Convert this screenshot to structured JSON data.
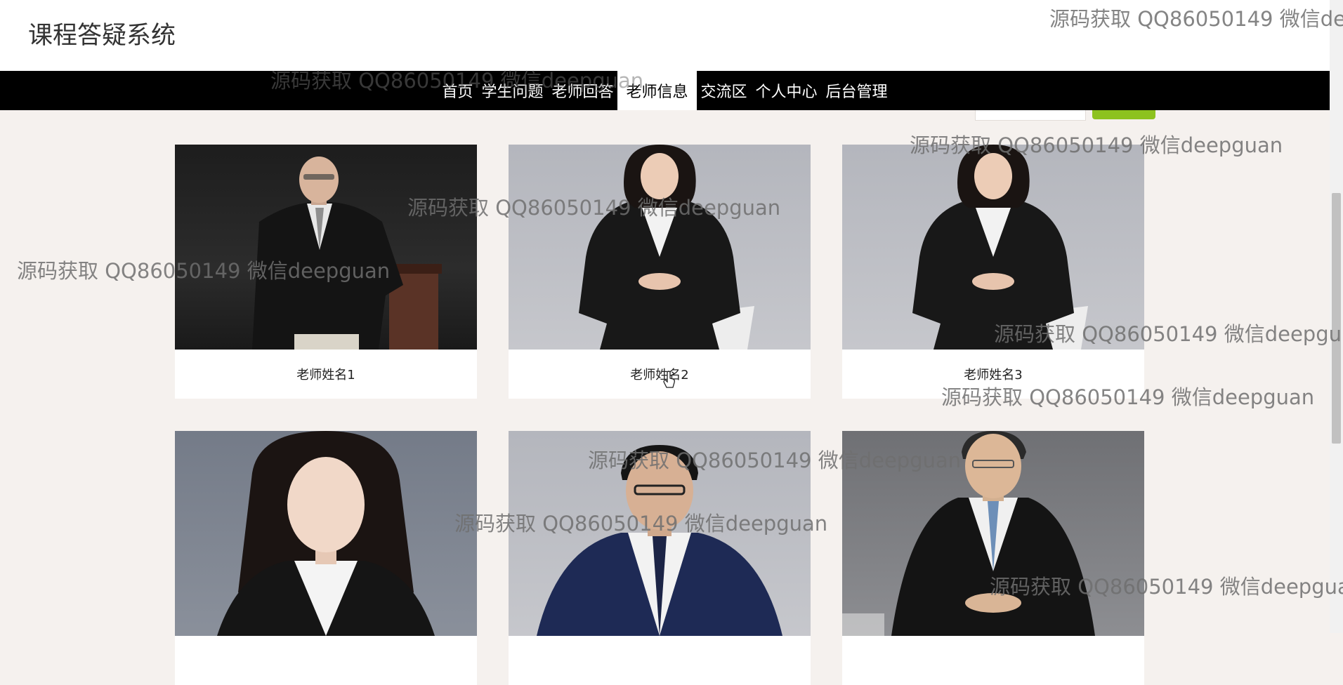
{
  "header": {
    "site_title": "课程答疑系统"
  },
  "nav": {
    "items": [
      {
        "label": "首页",
        "active": false
      },
      {
        "label": "学生问题",
        "active": false
      },
      {
        "label": "老师回答",
        "active": false
      },
      {
        "label": "老师信息",
        "active": true
      },
      {
        "label": "交流区",
        "active": false
      },
      {
        "label": "个人中心",
        "active": false
      },
      {
        "label": "后台管理",
        "active": false
      }
    ]
  },
  "teachers": [
    {
      "name": "老师姓名1",
      "photo": "man-glasses-suit-dark-bg"
    },
    {
      "name": "老师姓名2",
      "photo": "woman-suit-grey-bg"
    },
    {
      "name": "老师姓名3",
      "photo": "woman-suit-grey-bg"
    },
    {
      "name": "",
      "photo": "woman-long-hair-slate-bg"
    },
    {
      "name": "",
      "photo": "man-glasses-navy-suit"
    },
    {
      "name": "",
      "photo": "man-glasses-black-suit"
    }
  ],
  "watermarks": [
    "源码获取 QQ86050149 微信deepguan",
    "源码获取 QQ86050149 微信de",
    "源码获取 QQ86050149 微信deepgua",
    "源码获取 QQ86050149 微信deepgu"
  ],
  "colors": {
    "page_bg": "#f5f1ee",
    "nav_bg": "#000000",
    "accent_green": "#8dc21f"
  }
}
